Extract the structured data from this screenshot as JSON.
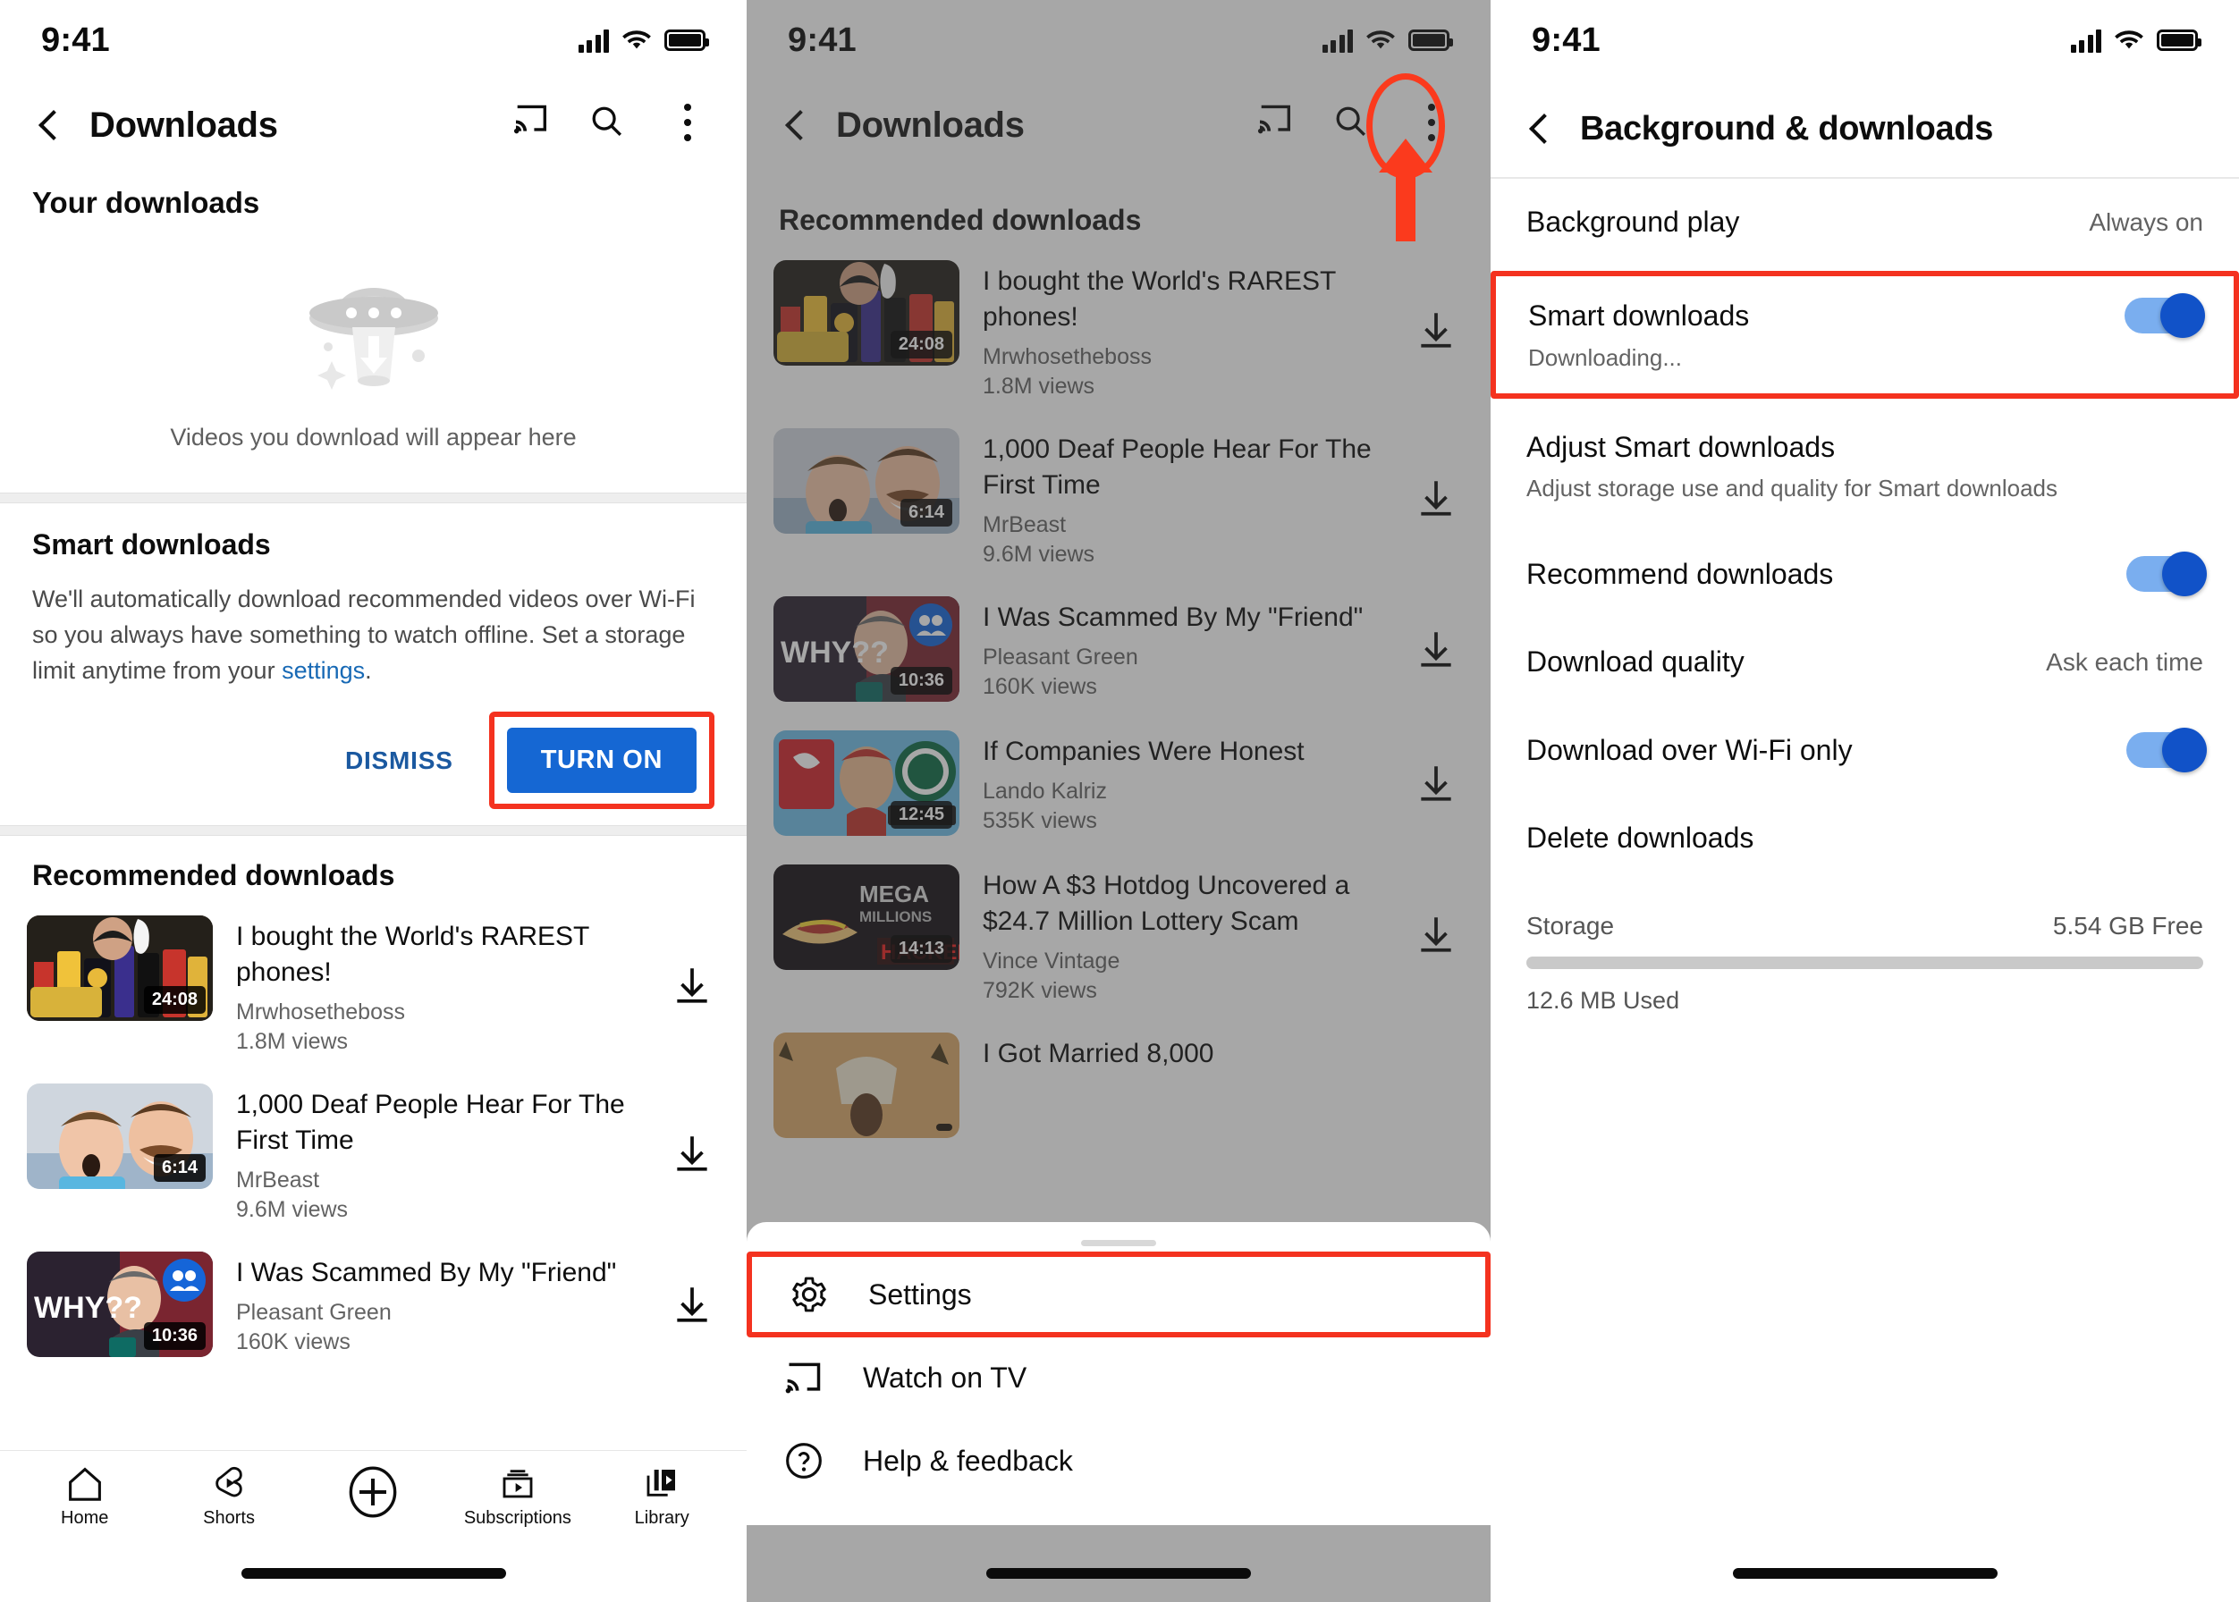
{
  "status_bar": {
    "time": "9:41"
  },
  "panel1": {
    "appbar": {
      "title": "Downloads",
      "back_icon": "chevron-left-icon",
      "cast_icon": "cast-icon",
      "search_icon": "search-icon",
      "more_icon": "kebab-menu-icon"
    },
    "your_downloads": {
      "heading": "Your downloads",
      "illustration": "ufo-download-illustration",
      "empty_text": "Videos you download will appear here"
    },
    "smart_downloads": {
      "title": "Smart downloads",
      "body_before_link": "We'll automatically download recommended videos over Wi-Fi so you always have something to watch offline. Set a storage limit anytime from your ",
      "link_text": "settings",
      "body_after_link": ".",
      "dismiss_label": "DISMISS",
      "turn_on_label": "TURN ON",
      "highlight_color": "#f4321f",
      "button_color": "#1567d3"
    },
    "recommended_heading": "Recommended downloads",
    "videos": [
      {
        "title": "I bought the World's RAREST phones!",
        "channel": "Mrwhosetheboss",
        "views": "1.8M views",
        "duration": "24:08",
        "download_icon": "download-icon"
      },
      {
        "title": "1,000 Deaf People Hear For The First Time",
        "channel": "MrBeast",
        "views": "9.6M views",
        "duration": "6:14",
        "download_icon": "download-icon"
      },
      {
        "title": "I Was Scammed By My \"Friend\"",
        "channel": "Pleasant Green",
        "views": "160K views",
        "duration": "10:36",
        "download_icon": "download-icon"
      }
    ],
    "bottom_nav": [
      {
        "label": "Home",
        "icon": "home-icon"
      },
      {
        "label": "Shorts",
        "icon": "shorts-icon"
      },
      {
        "label": "",
        "icon": "create-plus-icon"
      },
      {
        "label": "Subscriptions",
        "icon": "subscriptions-icon"
      },
      {
        "label": "Library",
        "icon": "library-icon"
      }
    ]
  },
  "panel2": {
    "appbar": {
      "title": "Downloads",
      "back_icon": "chevron-left-icon",
      "cast_icon": "cast-icon",
      "search_icon": "search-icon",
      "more_icon": "kebab-menu-icon"
    },
    "annotation": {
      "circle_target": "kebab-menu-icon",
      "arrow": "arrow-up",
      "color": "#fb3a1d"
    },
    "recommended_heading": "Recommended downloads",
    "videos": [
      {
        "title": "I bought the World's RAREST phones!",
        "channel": "Mrwhosetheboss",
        "views": "1.8M views",
        "duration": "24:08"
      },
      {
        "title": "1,000 Deaf People Hear For The First Time",
        "channel": "MrBeast",
        "views": "9.6M views",
        "duration": "6:14"
      },
      {
        "title": "I Was Scammed By My \"Friend\"",
        "channel": "Pleasant Green",
        "views": "160K views",
        "duration": "10:36"
      },
      {
        "title": "If Companies Were Honest",
        "channel": "Lando Kalriz",
        "views": "535K views",
        "duration": "12:45"
      },
      {
        "title": "How A $3 Hotdog Uncovered a $24.7 Million Lottery Scam",
        "channel": "Vince Vintage",
        "views": "792K views",
        "duration": "14:13"
      },
      {
        "title": "I Got Married 8,000",
        "channel": "",
        "views": "",
        "duration": ""
      }
    ],
    "sheet": {
      "items": [
        {
          "label": "Settings",
          "icon": "gear-icon",
          "highlighted": true
        },
        {
          "label": "Watch on TV",
          "icon": "cast-icon",
          "highlighted": false
        },
        {
          "label": "Help & feedback",
          "icon": "help-circle-icon",
          "highlighted": false
        }
      ]
    }
  },
  "panel3": {
    "appbar": {
      "title": "Background & downloads",
      "back_icon": "chevron-left-icon"
    },
    "rows": [
      {
        "label": "Background play",
        "value": "Always on",
        "type": "value"
      },
      {
        "label": "Smart downloads",
        "sub": "Downloading...",
        "type": "toggle",
        "toggle_on": true,
        "highlighted": true
      },
      {
        "label": "Adjust Smart downloads",
        "sub": "Adjust storage use and quality for Smart downloads",
        "type": "sub"
      },
      {
        "label": "Recommend downloads",
        "type": "toggle",
        "toggle_on": true
      },
      {
        "label": "Download quality",
        "value": "Ask each time",
        "type": "value"
      },
      {
        "label": "Download over Wi-Fi only",
        "type": "toggle",
        "toggle_on": true
      },
      {
        "label": "Delete downloads",
        "type": "plain"
      }
    ],
    "storage": {
      "label": "Storage",
      "free": "5.54 GB Free",
      "used": "12.6 MB Used",
      "bar_fill_percent": 0.3
    }
  }
}
